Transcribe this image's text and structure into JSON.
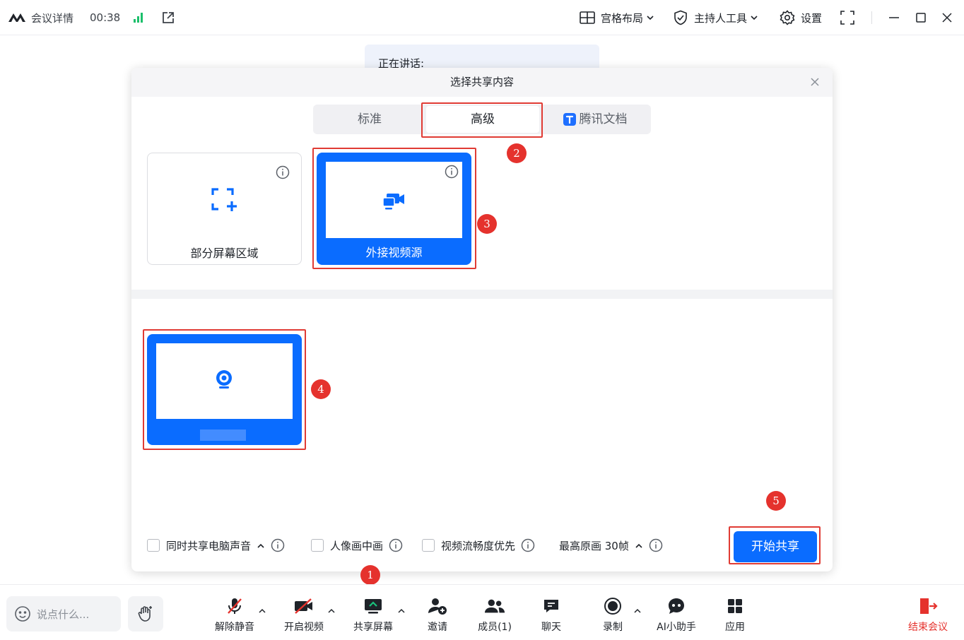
{
  "titlebar": {
    "meeting_details": "会议详情",
    "timer": "00:38",
    "layout_label": "宫格布局",
    "host_tools_label": "主持人工具",
    "settings_label": "设置"
  },
  "speaking": {
    "label": "正在讲话:"
  },
  "dialog": {
    "title": "选择共享内容",
    "tabs": [
      {
        "label": "标准",
        "active": false
      },
      {
        "label": "高级",
        "active": true
      },
      {
        "label": "腾讯文档",
        "active": false
      }
    ],
    "cards": [
      {
        "label": "部分屏幕区域",
        "selected": false
      },
      {
        "label": "外接视频源",
        "selected": true
      }
    ],
    "options": [
      {
        "label": "同时共享电脑声音",
        "checked": false
      },
      {
        "label": "人像画中画",
        "checked": false
      },
      {
        "label": "视频流畅度优先",
        "checked": false
      },
      {
        "label": "最高原画 30帧"
      }
    ],
    "start_button": "开始共享"
  },
  "annotations": [
    "1",
    "2",
    "3",
    "4",
    "5"
  ],
  "toolbar": {
    "chat_placeholder": "说点什么...",
    "buttons": [
      {
        "label": "解除静音",
        "icon": "mic-muted-icon"
      },
      {
        "label": "开启视频",
        "icon": "video-off-icon"
      },
      {
        "label": "共享屏幕",
        "icon": "share-screen-icon"
      },
      {
        "label": "邀请",
        "icon": "invite-icon"
      },
      {
        "label": "成员(1)",
        "icon": "members-icon"
      },
      {
        "label": "聊天",
        "icon": "chat-icon"
      },
      {
        "label": "录制",
        "icon": "record-icon"
      },
      {
        "label": "AI小助手",
        "icon": "ai-assistant-icon"
      },
      {
        "label": "应用",
        "icon": "apps-icon"
      }
    ],
    "end_meeting": "结束会议"
  },
  "colors": {
    "accent": "#0a6cff",
    "highlight": "#e03b34",
    "signal": "#1bbf6b",
    "end_meeting": "#e5322d"
  }
}
